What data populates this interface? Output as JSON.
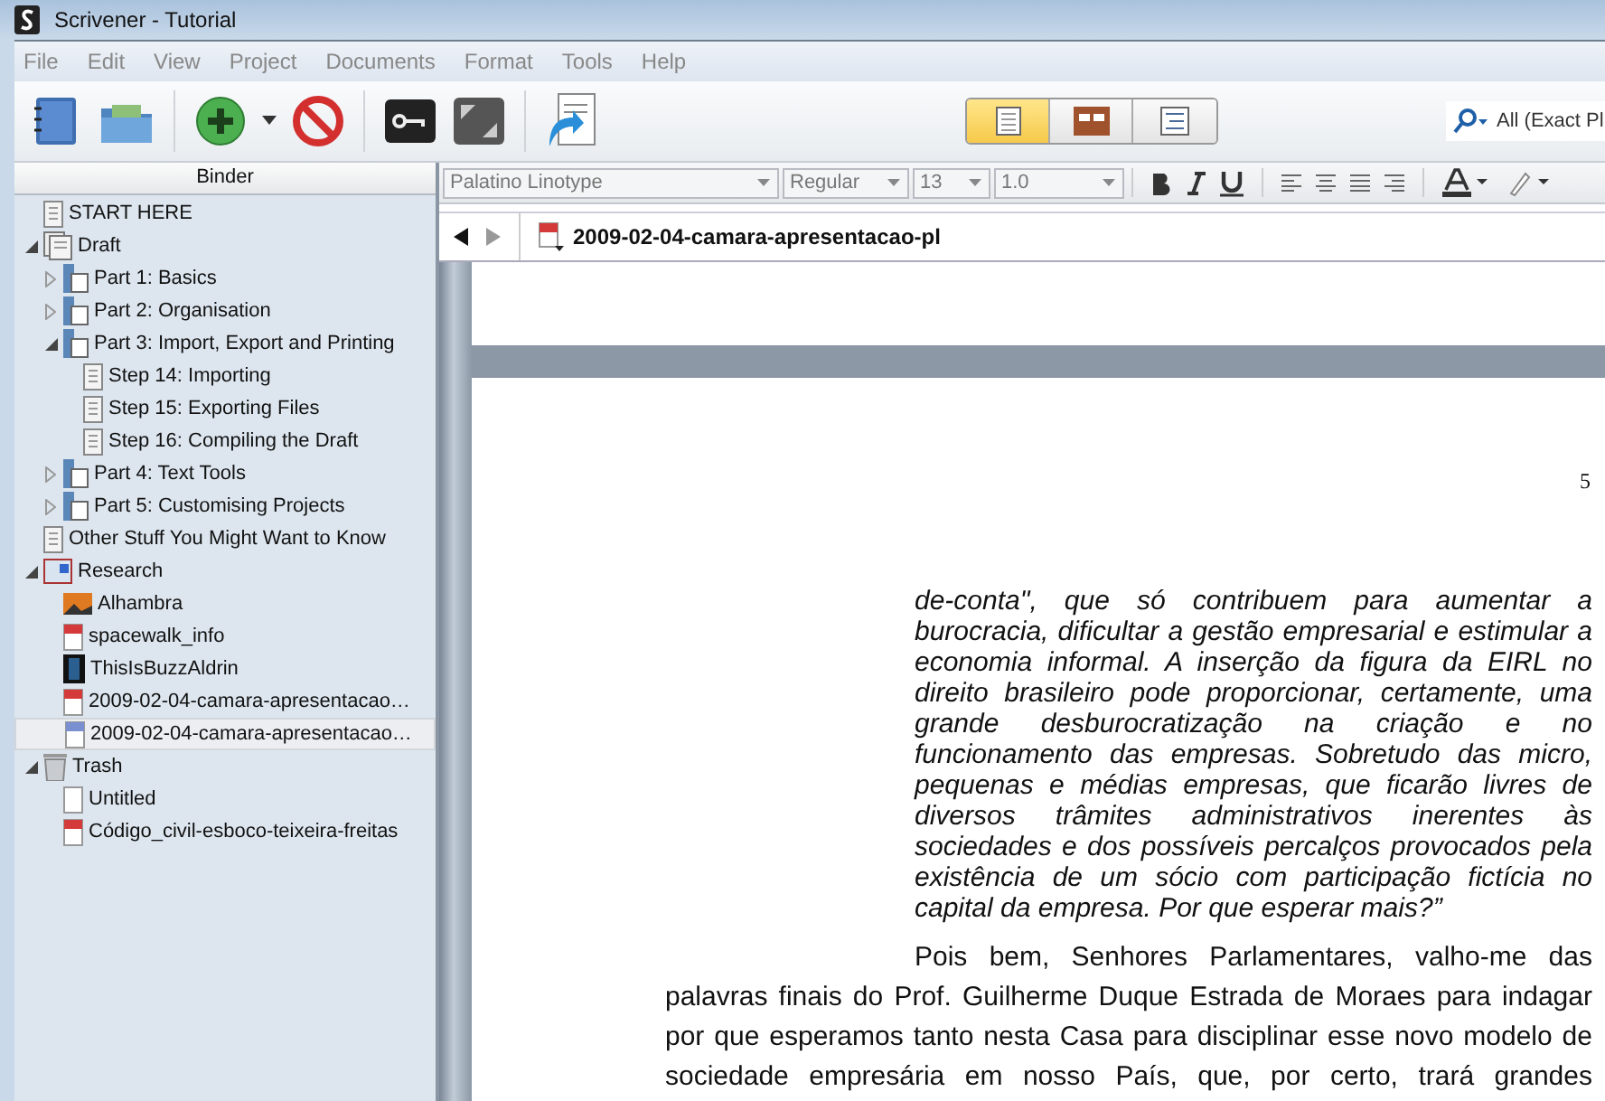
{
  "window": {
    "title": "Scrivener - Tutorial"
  },
  "menu": [
    "File",
    "Edit",
    "View",
    "Project",
    "Documents",
    "Format",
    "Tools",
    "Help"
  ],
  "view_modes": [
    {
      "kind": "page",
      "selected": true
    },
    {
      "kind": "corkboard",
      "selected": false
    },
    {
      "kind": "outline",
      "selected": false
    }
  ],
  "search": {
    "placeholder": "All (Exact Pl"
  },
  "binder": {
    "title": "Binder",
    "items": [
      {
        "label": "START HERE",
        "kind": "text",
        "selected": false
      },
      {
        "label": "Draft",
        "kind": "draft",
        "expanded": true,
        "selected": false,
        "children": [
          {
            "label": "Part 1: Basics",
            "kind": "folder",
            "expanded": false,
            "selected": false
          },
          {
            "label": "Part 2: Organisation",
            "kind": "folder",
            "expanded": false,
            "selected": false
          },
          {
            "label": "Part 3: Import, Export and Printing",
            "kind": "folder",
            "expanded": true,
            "selected": false,
            "children": [
              {
                "label": "Step 14: Importing",
                "kind": "text",
                "selected": false
              },
              {
                "label": "Step 15: Exporting Files",
                "kind": "text",
                "selected": false
              },
              {
                "label": "Step 16: Compiling the Draft",
                "kind": "text",
                "selected": false
              }
            ]
          },
          {
            "label": "Part 4: Text Tools",
            "kind": "folder",
            "expanded": false,
            "selected": false
          },
          {
            "label": "Part 5: Customising Projects",
            "kind": "folder",
            "expanded": false,
            "selected": false
          }
        ]
      },
      {
        "label": "Other Stuff You Might Want to Know",
        "kind": "text",
        "selected": false
      },
      {
        "label": "Research",
        "kind": "research",
        "expanded": true,
        "selected": false,
        "children": [
          {
            "label": "Alhambra",
            "kind": "image",
            "selected": false
          },
          {
            "label": "spacewalk_info",
            "kind": "pdf",
            "selected": false
          },
          {
            "label": "ThisIsBuzzAldrin",
            "kind": "movie",
            "selected": false
          },
          {
            "label": "2009-02-04-camara-apresentacao…",
            "kind": "pdf",
            "selected": false
          },
          {
            "label": "2009-02-04-camara-apresentacao…",
            "kind": "webpage",
            "selected": true
          }
        ]
      },
      {
        "label": "Trash",
        "kind": "trash",
        "expanded": true,
        "selected": false,
        "children": [
          {
            "label": "Untitled",
            "kind": "blank",
            "selected": false
          },
          {
            "label": "Código_civil-esboco-teixeira-freitas",
            "kind": "pdf",
            "selected": false
          }
        ]
      }
    ]
  },
  "format_bar": {
    "font": "Palatino Linotype",
    "style": "Regular",
    "size": "13",
    "line_spacing": "1.0"
  },
  "editor": {
    "document_title": "2009-02-04-camara-apresentacao-pl",
    "page_number": "5",
    "quote": "de-conta\", que só contribuem para aumentar a burocracia, dificultar a gestão empresarial e estimular a economia informal. A inserção da figura da EIRL no direito brasileiro pode proporcionar, certamente, uma grande desburocratização na criação e no funcionamento das empresas. Sobretudo das micro, pequenas e médias empresas, que ficarão livres de diversos trâmites administrativos inerentes às sociedades e dos possíveis percalços provocados pela existência de um sócio com participação fictícia no capital da empresa. Por que esperar mais?”",
    "paragraph": "Pois bem, Senhores Parlamentares, valho-me das palavras finais do Prof. Guilherme Duque Estrada de Moraes para indagar por que esperamos tanto nesta Casa para disciplinar esse novo modelo de sociedade empresária em nosso País, que, por certo, trará grandes"
  }
}
